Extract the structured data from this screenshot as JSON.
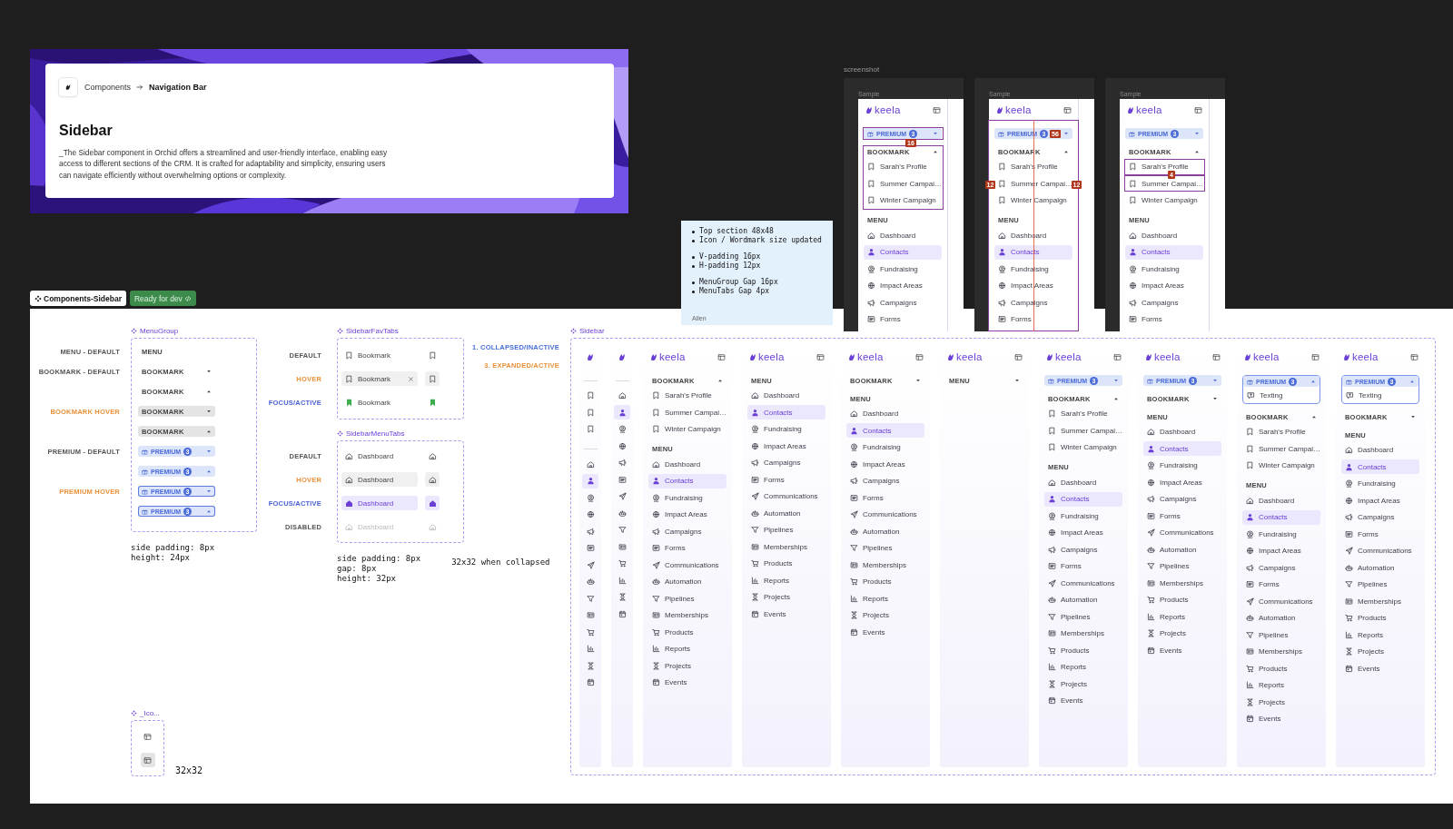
{
  "banner": {
    "kind": "picture",
    "breadcrumb": [
      "Components",
      "Navigation Bar"
    ],
    "title": "Sidebar",
    "description": "_The Sidebar component in Orchid offers a streamlined and user-friendly interface, enabling easy access to different sections of the CRM. It is crafted for adaptability and simplicity, ensuring users can navigate efficiently without overwhelming options or complexity."
  },
  "sticky_note": {
    "groups": [
      [
        "Top section 48x48",
        "Icon / Wordmark size updated"
      ],
      [
        "V-padding 16px",
        "H-padding 12px"
      ],
      [
        "MenuGroup Gap 16px",
        "MenuTabs Gap 4px"
      ]
    ],
    "author": "Allen"
  },
  "screenshot_section": {
    "label": "screenshot",
    "samples": [
      {
        "label": "Sample",
        "measures": [
          "16"
        ],
        "sidebar": {
          "wordmark": "keela",
          "collapsed": false,
          "premium": {
            "label": "PREMIUM",
            "count": "3",
            "expanded": false
          },
          "groups": [
            {
              "kind": "bookmark",
              "label": "BOOKMARK",
              "expanded": true,
              "items": [
                {
                  "label": "Sarah's Profile",
                  "selected": false
                },
                {
                  "label": "Summer Campai…",
                  "selected": false
                },
                {
                  "label": "Winter Campaign",
                  "selected": false
                }
              ]
            },
            {
              "kind": "menu",
              "label": "MENU",
              "expanded": true,
              "items": [
                {
                  "label": "Dashboard",
                  "selected": false
                },
                {
                  "label": "Contacts",
                  "selected": true
                },
                {
                  "label": "Fundraising",
                  "selected": false
                },
                {
                  "label": "Impact Areas",
                  "selected": false
                },
                {
                  "label": "Campaigns",
                  "selected": false
                },
                {
                  "label": "Forms",
                  "selected": false
                }
              ]
            }
          ]
        }
      },
      {
        "label": "Sample",
        "measures": [
          "56",
          "12",
          "12"
        ],
        "sidebar": {
          "wordmark": "keela",
          "collapsed": false,
          "premium": {
            "label": "PREMIUM",
            "count": "3",
            "expanded": false
          },
          "groups": [
            {
              "kind": "bookmark",
              "label": "BOOKMARK",
              "expanded": true,
              "items": [
                {
                  "label": "Sarah's Profile",
                  "selected": false
                },
                {
                  "label": "Summer Campai…",
                  "selected": false
                },
                {
                  "label": "Winter Campaign",
                  "selected": false
                }
              ]
            },
            {
              "kind": "menu",
              "label": "MENU",
              "expanded": true,
              "items": [
                {
                  "label": "Dashboard",
                  "selected": false
                },
                {
                  "label": "Contacts",
                  "selected": true
                },
                {
                  "label": "Fundraising",
                  "selected": false
                },
                {
                  "label": "Impact Areas",
                  "selected": false
                },
                {
                  "label": "Campaigns",
                  "selected": false
                },
                {
                  "label": "Forms",
                  "selected": false
                }
              ]
            }
          ]
        }
      },
      {
        "label": "Sample",
        "measures": [
          "4"
        ],
        "sidebar": {
          "wordmark": "keela",
          "collapsed": false,
          "premium": {
            "label": "PREMIUM",
            "count": "3",
            "expanded": false
          },
          "groups": [
            {
              "kind": "bookmark",
              "label": "BOOKMARK",
              "expanded": true,
              "items": [
                {
                  "label": "Sarah's Profile",
                  "selected": false
                },
                {
                  "label": "Summer Campai…",
                  "selected": false
                },
                {
                  "label": "Winter Campaign",
                  "selected": false
                }
              ]
            },
            {
              "kind": "menu",
              "label": "MENU",
              "expanded": true,
              "items": [
                {
                  "label": "Dashboard",
                  "selected": false
                },
                {
                  "label": "Contacts",
                  "selected": true
                },
                {
                  "label": "Fundraising",
                  "selected": false
                },
                {
                  "label": "Impact Areas",
                  "selected": false
                },
                {
                  "label": "Campaigns",
                  "selected": false
                },
                {
                  "label": "Forms",
                  "selected": false
                }
              ]
            }
          ]
        }
      }
    ]
  },
  "page_tags": {
    "frame_name": "Components-Sidebar",
    "status": "Ready for dev"
  },
  "canvas": {
    "menu_group": {
      "title": "MenuGroup",
      "rows": [
        {
          "kind": "menu",
          "label": "MENU",
          "expanded": true,
          "state_label": {
            "text": "MENU - DEFAULT",
            "color": "#555555"
          }
        },
        {
          "kind": "bookmark",
          "label": "BOOKMARK",
          "expanded": false,
          "hover": false,
          "state_label": {
            "text": "BOOKMARK - DEFAULT",
            "color": "#555555"
          }
        },
        {
          "kind": "bookmark",
          "label": "BOOKMARK",
          "expanded": true,
          "hover": false
        },
        {
          "kind": "bookmark",
          "label": "BOOKMARK",
          "expanded": false,
          "hover": true,
          "state_label": {
            "text": "BOOKMARK HOVER",
            "color": "#e8913a"
          }
        },
        {
          "kind": "bookmark",
          "label": "BOOKMARK",
          "expanded": true,
          "hover": true
        },
        {
          "kind": "premium",
          "label": "PREMIUM",
          "count": "3",
          "expanded": false,
          "hover": false,
          "state_label": {
            "text": "PREMIUM - DEFAULT",
            "color": "#555555"
          }
        },
        {
          "kind": "premium",
          "label": "PREMIUM",
          "count": "3",
          "expanded": true,
          "hover": false
        },
        {
          "kind": "premium",
          "label": "PREMIUM",
          "count": "3",
          "expanded": false,
          "hover": true,
          "state_label": {
            "text": "PREMIUM HOVER",
            "color": "#e8913a"
          }
        },
        {
          "kind": "premium",
          "label": "PREMIUM",
          "count": "3",
          "expanded": true,
          "hover": true
        }
      ],
      "note": [
        "side padding: 8px",
        "height: 24px"
      ]
    },
    "fav_tabs": {
      "title": "SidebarFavTabs",
      "rows": [
        {
          "label": "Bookmark",
          "kind": "default",
          "state_label": {
            "text": "DEFAULT",
            "color": "#555555"
          }
        },
        {
          "label": "Bookmark",
          "kind": "hover",
          "state_label": {
            "text": "HOVER",
            "color": "#e8913a"
          }
        },
        {
          "label": "Bookmark",
          "kind": "active",
          "state_label": {
            "text": "FOCUS/ACTIVE",
            "color": "#4a5fd0"
          }
        }
      ]
    },
    "menu_tabs": {
      "title": "SidebarMenuTabs",
      "rows": [
        {
          "label": "Dashboard",
          "kind": "default",
          "state_label": {
            "text": "DEFAULT",
            "color": "#555555"
          }
        },
        {
          "label": "Dashboard",
          "kind": "hover",
          "state_label": {
            "text": "HOVER",
            "color": "#e8913a"
          }
        },
        {
          "label": "Dashboard",
          "kind": "active",
          "state_label": {
            "text": "FOCUS/ACTIVE",
            "color": "#4a5fd0"
          }
        },
        {
          "label": "Dashboard",
          "kind": "disabled",
          "state_label": {
            "text": "DISABLED",
            "color": "#555555"
          }
        }
      ],
      "note": [
        "side padding: 8px",
        "gap: 8px",
        "height: 32px"
      ],
      "side_note": "32x32 when collapsed"
    },
    "legend": [
      {
        "text": "1. COLLAPSED/INACTIVE",
        "color": "#4a6fd8"
      },
      {
        "text": "3. EXPANDED/ACTIVE",
        "color": "#e8913a"
      }
    ],
    "icon_set": {
      "title": "_Ico...",
      "rows": [
        {
          "hover": false
        },
        {
          "hover": true
        }
      ],
      "note": "32x32"
    },
    "sidebar": {
      "title": "Sidebar",
      "variants": [
        {
          "collapsed": true,
          "groups": [
            {
              "kind": "bookmark",
              "items": [
                {
                  "selected": false
                },
                {
                  "selected": false
                },
                {
                  "selected": false
                }
              ]
            },
            {
              "kind": "menu",
              "items": [
                {
                  "selected": false
                },
                {
                  "selected": true
                },
                {
                  "selected": false
                },
                {
                  "selected": false
                },
                {
                  "selected": false
                },
                {
                  "selected": false
                },
                {
                  "selected": false
                },
                {
                  "selected": false
                },
                {
                  "selected": false
                },
                {
                  "selected": false
                },
                {
                  "selected": false
                },
                {
                  "selected": false
                },
                {
                  "selected": false
                },
                {
                  "selected": false
                }
              ]
            }
          ]
        },
        {
          "collapsed": true,
          "groups": [
            {
              "kind": "menu",
              "items": [
                {
                  "selected": false
                },
                {
                  "selected": true
                },
                {
                  "selected": false
                },
                {
                  "selected": false
                },
                {
                  "selected": false
                },
                {
                  "selected": false
                },
                {
                  "selected": false
                },
                {
                  "selected": false
                },
                {
                  "selected": false
                },
                {
                  "selected": false
                },
                {
                  "selected": false
                },
                {
                  "selected": false
                },
                {
                  "selected": false
                },
                {
                  "selected": false
                }
              ]
            }
          ]
        },
        {
          "wordmark": "keela",
          "collapsed": false,
          "groups": [
            {
              "kind": "bookmark",
              "label": "BOOKMARK",
              "expanded": true,
              "items": [
                {
                  "label": "Sarah's Profile",
                  "selected": false
                },
                {
                  "label": "Summer Campai…",
                  "selected": false
                },
                {
                  "label": "Winter Campaign",
                  "selected": false
                }
              ]
            },
            {
              "kind": "menu",
              "label": "MENU",
              "expanded": true,
              "items": [
                {
                  "label": "Dashboard",
                  "selected": false
                },
                {
                  "label": "Contacts",
                  "selected": true
                },
                {
                  "label": "Fundraising",
                  "selected": false
                },
                {
                  "label": "Impact Areas",
                  "selected": false
                },
                {
                  "label": "Campaigns",
                  "selected": false
                },
                {
                  "label": "Forms",
                  "selected": false
                },
                {
                  "label": "Communications",
                  "selected": false
                },
                {
                  "label": "Automation",
                  "selected": false
                },
                {
                  "label": "Pipelines",
                  "selected": false
                },
                {
                  "label": "Memberships",
                  "selected": false
                },
                {
                  "label": "Products",
                  "selected": false
                },
                {
                  "label": "Reports",
                  "selected": false
                },
                {
                  "label": "Projects",
                  "selected": false
                },
                {
                  "label": "Events",
                  "selected": false
                }
              ]
            }
          ]
        },
        {
          "wordmark": "keela",
          "collapsed": false,
          "groups": [
            {
              "kind": "menu",
              "label": "MENU",
              "expanded": true,
              "items": [
                {
                  "label": "Dashboard",
                  "selected": false
                },
                {
                  "label": "Contacts",
                  "selected": true
                },
                {
                  "label": "Fundraising",
                  "selected": false
                },
                {
                  "label": "Impact Areas",
                  "selected": false
                },
                {
                  "label": "Campaigns",
                  "selected": false
                },
                {
                  "label": "Forms",
                  "selected": false
                },
                {
                  "label": "Communications",
                  "selected": false
                },
                {
                  "label": "Automation",
                  "selected": false
                },
                {
                  "label": "Pipelines",
                  "selected": false
                },
                {
                  "label": "Memberships",
                  "selected": false
                },
                {
                  "label": "Products",
                  "selected": false
                },
                {
                  "label": "Reports",
                  "selected": false
                },
                {
                  "label": "Projects",
                  "selected": false
                },
                {
                  "label": "Events",
                  "selected": false
                }
              ]
            }
          ]
        },
        {
          "wordmark": "keela",
          "collapsed": false,
          "groups": [
            {
              "kind": "bookmark",
              "label": "BOOKMARK",
              "expanded": false
            },
            {
              "kind": "menu",
              "label": "MENU",
              "expanded": true,
              "items": [
                {
                  "label": "Dashboard",
                  "selected": false
                },
                {
                  "label": "Contacts",
                  "selected": true
                },
                {
                  "label": "Fundraising",
                  "selected": false
                },
                {
                  "label": "Impact Areas",
                  "selected": false
                },
                {
                  "label": "Campaigns",
                  "selected": false
                },
                {
                  "label": "Forms",
                  "selected": false
                },
                {
                  "label": "Communications",
                  "selected": false
                },
                {
                  "label": "Automation",
                  "selected": false
                },
                {
                  "label": "Pipelines",
                  "selected": false
                },
                {
                  "label": "Memberships",
                  "selected": false
                },
                {
                  "label": "Products",
                  "selected": false
                },
                {
                  "label": "Reports",
                  "selected": false
                },
                {
                  "label": "Projects",
                  "selected": false
                },
                {
                  "label": "Events",
                  "selected": false
                }
              ]
            }
          ]
        },
        {
          "wordmark": "keela",
          "collapsed": false,
          "groups": [
            {
              "kind": "menu",
              "label": "MENU",
              "expanded": false
            }
          ]
        },
        {
          "wordmark": "keela",
          "collapsed": false,
          "premium": {
            "label": "PREMIUM",
            "count": "3",
            "expanded": false
          },
          "groups": [
            {
              "kind": "bookmark",
              "label": "BOOKMARK",
              "expanded": true,
              "items": [
                {
                  "label": "Sarah's Profile",
                  "selected": false
                },
                {
                  "label": "Summer Campai…",
                  "selected": false
                },
                {
                  "label": "Winter Campaign",
                  "selected": false
                }
              ]
            },
            {
              "kind": "menu",
              "label": "MENU",
              "expanded": true,
              "items": [
                {
                  "label": "Dashboard",
                  "selected": false
                },
                {
                  "label": "Contacts",
                  "selected": true
                },
                {
                  "label": "Fundraising",
                  "selected": false
                },
                {
                  "label": "Impact Areas",
                  "selected": false
                },
                {
                  "label": "Campaigns",
                  "selected": false
                },
                {
                  "label": "Forms",
                  "selected": false
                },
                {
                  "label": "Communications",
                  "selected": false
                },
                {
                  "label": "Automation",
                  "selected": false
                },
                {
                  "label": "Pipelines",
                  "selected": false
                },
                {
                  "label": "Memberships",
                  "selected": false
                },
                {
                  "label": "Products",
                  "selected": false
                },
                {
                  "label": "Reports",
                  "selected": false
                },
                {
                  "label": "Projects",
                  "selected": false
                },
                {
                  "label": "Events",
                  "selected": false
                }
              ]
            }
          ]
        },
        {
          "wordmark": "keela",
          "collapsed": false,
          "premium": {
            "label": "PREMIUM",
            "count": "3",
            "expanded": false
          },
          "groups": [
            {
              "kind": "bookmark",
              "label": "BOOKMARK",
              "expanded": false
            },
            {
              "kind": "menu",
              "label": "MENU",
              "expanded": true,
              "items": [
                {
                  "label": "Dashboard",
                  "selected": false
                },
                {
                  "label": "Contacts",
                  "selected": true
                },
                {
                  "label": "Fundraising",
                  "selected": false
                },
                {
                  "label": "Impact Areas",
                  "selected": false
                },
                {
                  "label": "Campaigns",
                  "selected": false
                },
                {
                  "label": "Forms",
                  "selected": false
                },
                {
                  "label": "Communications",
                  "selected": false
                },
                {
                  "label": "Automation",
                  "selected": false
                },
                {
                  "label": "Pipelines",
                  "selected": false
                },
                {
                  "label": "Memberships",
                  "selected": false
                },
                {
                  "label": "Products",
                  "selected": false
                },
                {
                  "label": "Reports",
                  "selected": false
                },
                {
                  "label": "Projects",
                  "selected": false
                },
                {
                  "label": "Events",
                  "selected": false
                }
              ]
            }
          ]
        },
        {
          "wordmark": "keela",
          "collapsed": false,
          "premium": {
            "label": "PREMIUM",
            "count": "3",
            "expanded": true,
            "items": [
              {
                "label": "Texting",
                "selected": false
              }
            ]
          },
          "groups": [
            {
              "kind": "bookmark",
              "label": "BOOKMARK",
              "expanded": true,
              "items": [
                {
                  "label": "Sarah's Profile",
                  "selected": false
                },
                {
                  "label": "Summer Campai…",
                  "selected": false
                },
                {
                  "label": "Winter Campaign",
                  "selected": false
                }
              ]
            },
            {
              "kind": "menu",
              "label": "MENU",
              "expanded": true,
              "items": [
                {
                  "label": "Dashboard",
                  "selected": false
                },
                {
                  "label": "Contacts",
                  "selected": true
                },
                {
                  "label": "Fundraising",
                  "selected": false
                },
                {
                  "label": "Impact Areas",
                  "selected": false
                },
                {
                  "label": "Campaigns",
                  "selected": false
                },
                {
                  "label": "Forms",
                  "selected": false
                },
                {
                  "label": "Communications",
                  "selected": false
                },
                {
                  "label": "Automation",
                  "selected": false
                },
                {
                  "label": "Pipelines",
                  "selected": false
                },
                {
                  "label": "Memberships",
                  "selected": false
                },
                {
                  "label": "Products",
                  "selected": false
                },
                {
                  "label": "Reports",
                  "selected": false
                },
                {
                  "label": "Projects",
                  "selected": false
                },
                {
                  "label": "Events",
                  "selected": false
                }
              ]
            }
          ]
        },
        {
          "wordmark": "keela",
          "collapsed": false,
          "premium": {
            "label": "PREMIUM",
            "count": "3",
            "expanded": true,
            "items": [
              {
                "label": "Texting",
                "selected": false
              }
            ]
          },
          "groups": [
            {
              "kind": "bookmark",
              "label": "BOOKMARK",
              "expanded": false
            },
            {
              "kind": "menu",
              "label": "MENU",
              "expanded": true,
              "items": [
                {
                  "label": "Dashboard",
                  "selected": false
                },
                {
                  "label": "Contacts",
                  "selected": true
                },
                {
                  "label": "Fundraising",
                  "selected": false
                },
                {
                  "label": "Impact Areas",
                  "selected": false
                },
                {
                  "label": "Campaigns",
                  "selected": false
                },
                {
                  "label": "Forms",
                  "selected": false
                },
                {
                  "label": "Communications",
                  "selected": false
                },
                {
                  "label": "Automation",
                  "selected": false
                },
                {
                  "label": "Pipelines",
                  "selected": false
                },
                {
                  "label": "Memberships",
                  "selected": false
                },
                {
                  "label": "Products",
                  "selected": false
                },
                {
                  "label": "Reports",
                  "selected": false
                },
                {
                  "label": "Projects",
                  "selected": false
                },
                {
                  "label": "Events",
                  "selected": false
                }
              ]
            }
          ]
        }
      ]
    }
  }
}
